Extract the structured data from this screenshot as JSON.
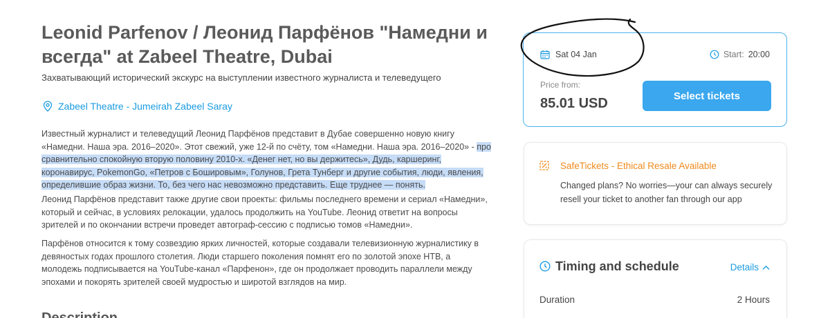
{
  "event": {
    "title": "Leonid Parfenov / Леонид Парфёнов \"Намедни и всегда\" at Zabeel Theatre, Dubai",
    "subtitle": "Захватывающий исторический экскурс на выступлении известного журналиста и телеведущего",
    "venue": "Zabeel Theatre - Jumeirah Zabeel Saray"
  },
  "description": {
    "p1_plain": "Известный журналист и телеведущий Леонид Парфёнов представит в Дубае совершенно новую книгу «Намедни. Наша эра. 2016–2020». Этот свежий, уже 12-й по счёту, том «Намедни. Наша эра. 2016–2020» -",
    "p1_highlighted": "про сравнительно спокойную вторую половину 2010-х. «Денег нет, но вы держитесь», Дудь, каршеринг, коронавирус, PokemonGo, «Петров с Бошировым», Голунов, Грета Тунберг и другие события, люди, явления, определившие образ жизни. То, без чего нас невозможно представить. Еще труднее — понять.",
    "p2": "Леонид Парфёнов представит также другие свои проекты: фильмы последнего времени и сериал «Намедни», который и сейчас, в условиях релокации, удалось продолжить на YouTube. Леонид ответит на вопросы зрителей и по окончании встречи проведет автограф-сессию с подписью томов «Намедни».",
    "p3": "Парфёнов относится к тому созвездию ярких личностей, которые создавали телевизионную журналистику в девяностых годах прошлого столетия. Люди старшего поколения помнят его по золотой эпохе НТВ, а молодежь подписывается на YouTube-канал «Парфенон», где он продолжает проводить параллели между эпохами и покорять зрителей своей мудростью и широтой взглядов на мир.",
    "heading": "Description"
  },
  "ticket": {
    "date": "Sat 04 Jan",
    "start_label": "Start:",
    "start_time": "20:00",
    "price_label": "Price from:",
    "price": "85.01 USD",
    "select_label": "Select tickets"
  },
  "safe": {
    "title": "SafeTickets - Ethical Resale Available",
    "text": "Changed plans? No worries—your can always securely resell your ticket to another fan through our app"
  },
  "timing": {
    "title": "Timing and schedule",
    "details_label": "Details",
    "duration_label": "Duration",
    "duration_value": "2 Hours"
  },
  "colors": {
    "accent": "#1a9be0",
    "button": "#3aa7ee",
    "safe_orange": "#f08a1c",
    "highlight": "#c6dcf7"
  }
}
